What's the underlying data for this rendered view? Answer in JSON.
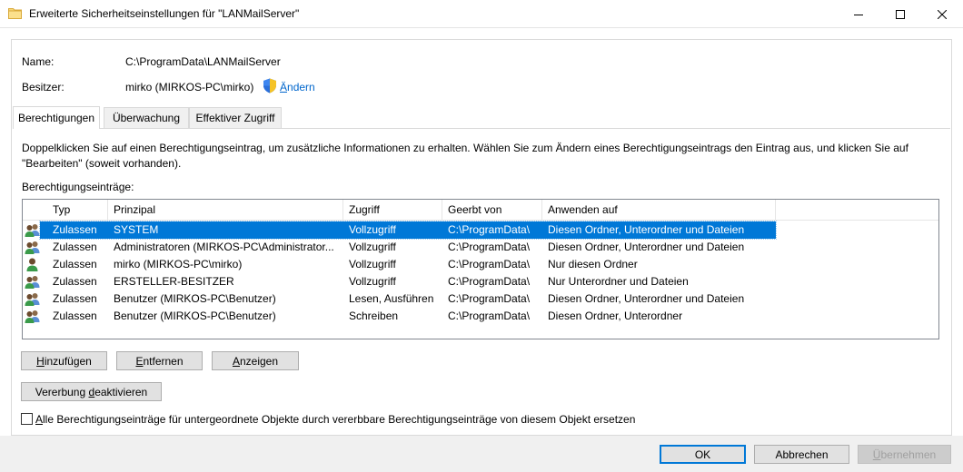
{
  "window": {
    "title": "Erweiterte Sicherheitseinstellungen für \"LANMailServer\""
  },
  "info": {
    "name_label": "Name:",
    "name_value": "C:\\ProgramData\\LANMailServer",
    "owner_label": "Besitzer:",
    "owner_value": "mirko (MIRKOS-PC\\mirko)",
    "change_link": "Ändern"
  },
  "tabs": [
    {
      "label": "Berechtigungen",
      "active": true
    },
    {
      "label": "Überwachung",
      "active": false
    },
    {
      "label": "Effektiver Zugriff",
      "active": false
    }
  ],
  "panel": {
    "description_line1": "Doppelklicken Sie auf einen Berechtigungseintrag, um zusätzliche Informationen zu erhalten. Wählen Sie zum Ändern eines Berechtigungseintrags den Eintrag aus, und klicken Sie auf",
    "description_line2": "\"Bearbeiten\" (soweit vorhanden).",
    "entries_label": "Berechtigungseinträge:"
  },
  "table": {
    "columns": [
      "Typ",
      "Prinzipal",
      "Zugriff",
      "Geerbt von",
      "Anwenden auf"
    ],
    "rows": [
      {
        "icon": "group-users-icon",
        "type": "Zulassen",
        "principal": "SYSTEM",
        "access": "Vollzugriff",
        "inherited": "C:\\ProgramData\\",
        "applies": "Diesen Ordner, Unterordner und Dateien",
        "selected": true
      },
      {
        "icon": "group-users-icon",
        "type": "Zulassen",
        "principal": "Administratoren (MIRKOS-PC\\Administrator...",
        "access": "Vollzugriff",
        "inherited": "C:\\ProgramData\\",
        "applies": "Diesen Ordner, Unterordner und Dateien",
        "selected": false
      },
      {
        "icon": "single-user-icon",
        "type": "Zulassen",
        "principal": "mirko (MIRKOS-PC\\mirko)",
        "access": "Vollzugriff",
        "inherited": "C:\\ProgramData\\",
        "applies": "Nur diesen Ordner",
        "selected": false
      },
      {
        "icon": "group-users-icon",
        "type": "Zulassen",
        "principal": "ERSTELLER-BESITZER",
        "access": "Vollzugriff",
        "inherited": "C:\\ProgramData\\",
        "applies": "Nur Unterordner und Dateien",
        "selected": false
      },
      {
        "icon": "group-users-icon",
        "type": "Zulassen",
        "principal": "Benutzer (MIRKOS-PC\\Benutzer)",
        "access": "Lesen, Ausführen",
        "inherited": "C:\\ProgramData\\",
        "applies": "Diesen Ordner, Unterordner und Dateien",
        "selected": false
      },
      {
        "icon": "group-users-icon",
        "type": "Zulassen",
        "principal": "Benutzer (MIRKOS-PC\\Benutzer)",
        "access": "Schreiben",
        "inherited": "C:\\ProgramData\\",
        "applies": "Diesen Ordner, Unterordner",
        "selected": false
      }
    ]
  },
  "buttons": {
    "add": {
      "mnemonic": "H",
      "rest": "inzufügen"
    },
    "remove": {
      "mnemonic": "E",
      "rest": "ntfernen"
    },
    "view": {
      "mnemonic": "A",
      "rest": "nzeigen"
    },
    "inheritance": {
      "before": "Vererbung ",
      "mnemonic": "d",
      "rest": "eaktivieren"
    },
    "ok": "OK",
    "cancel": "Abbrechen",
    "apply": {
      "mnemonic": "Ü",
      "rest": "bernehmen"
    }
  },
  "checkbox": {
    "checked": false,
    "mnemonic": "A",
    "rest": "lle Berechtigungseinträge für untergeordnete Objekte durch vererbbare Berechtigungseinträge von diesem Objekt ersetzen"
  },
  "colors": {
    "selection": "#0078d7",
    "link": "#0066cc",
    "footer_bg": "#f0f0f0"
  }
}
